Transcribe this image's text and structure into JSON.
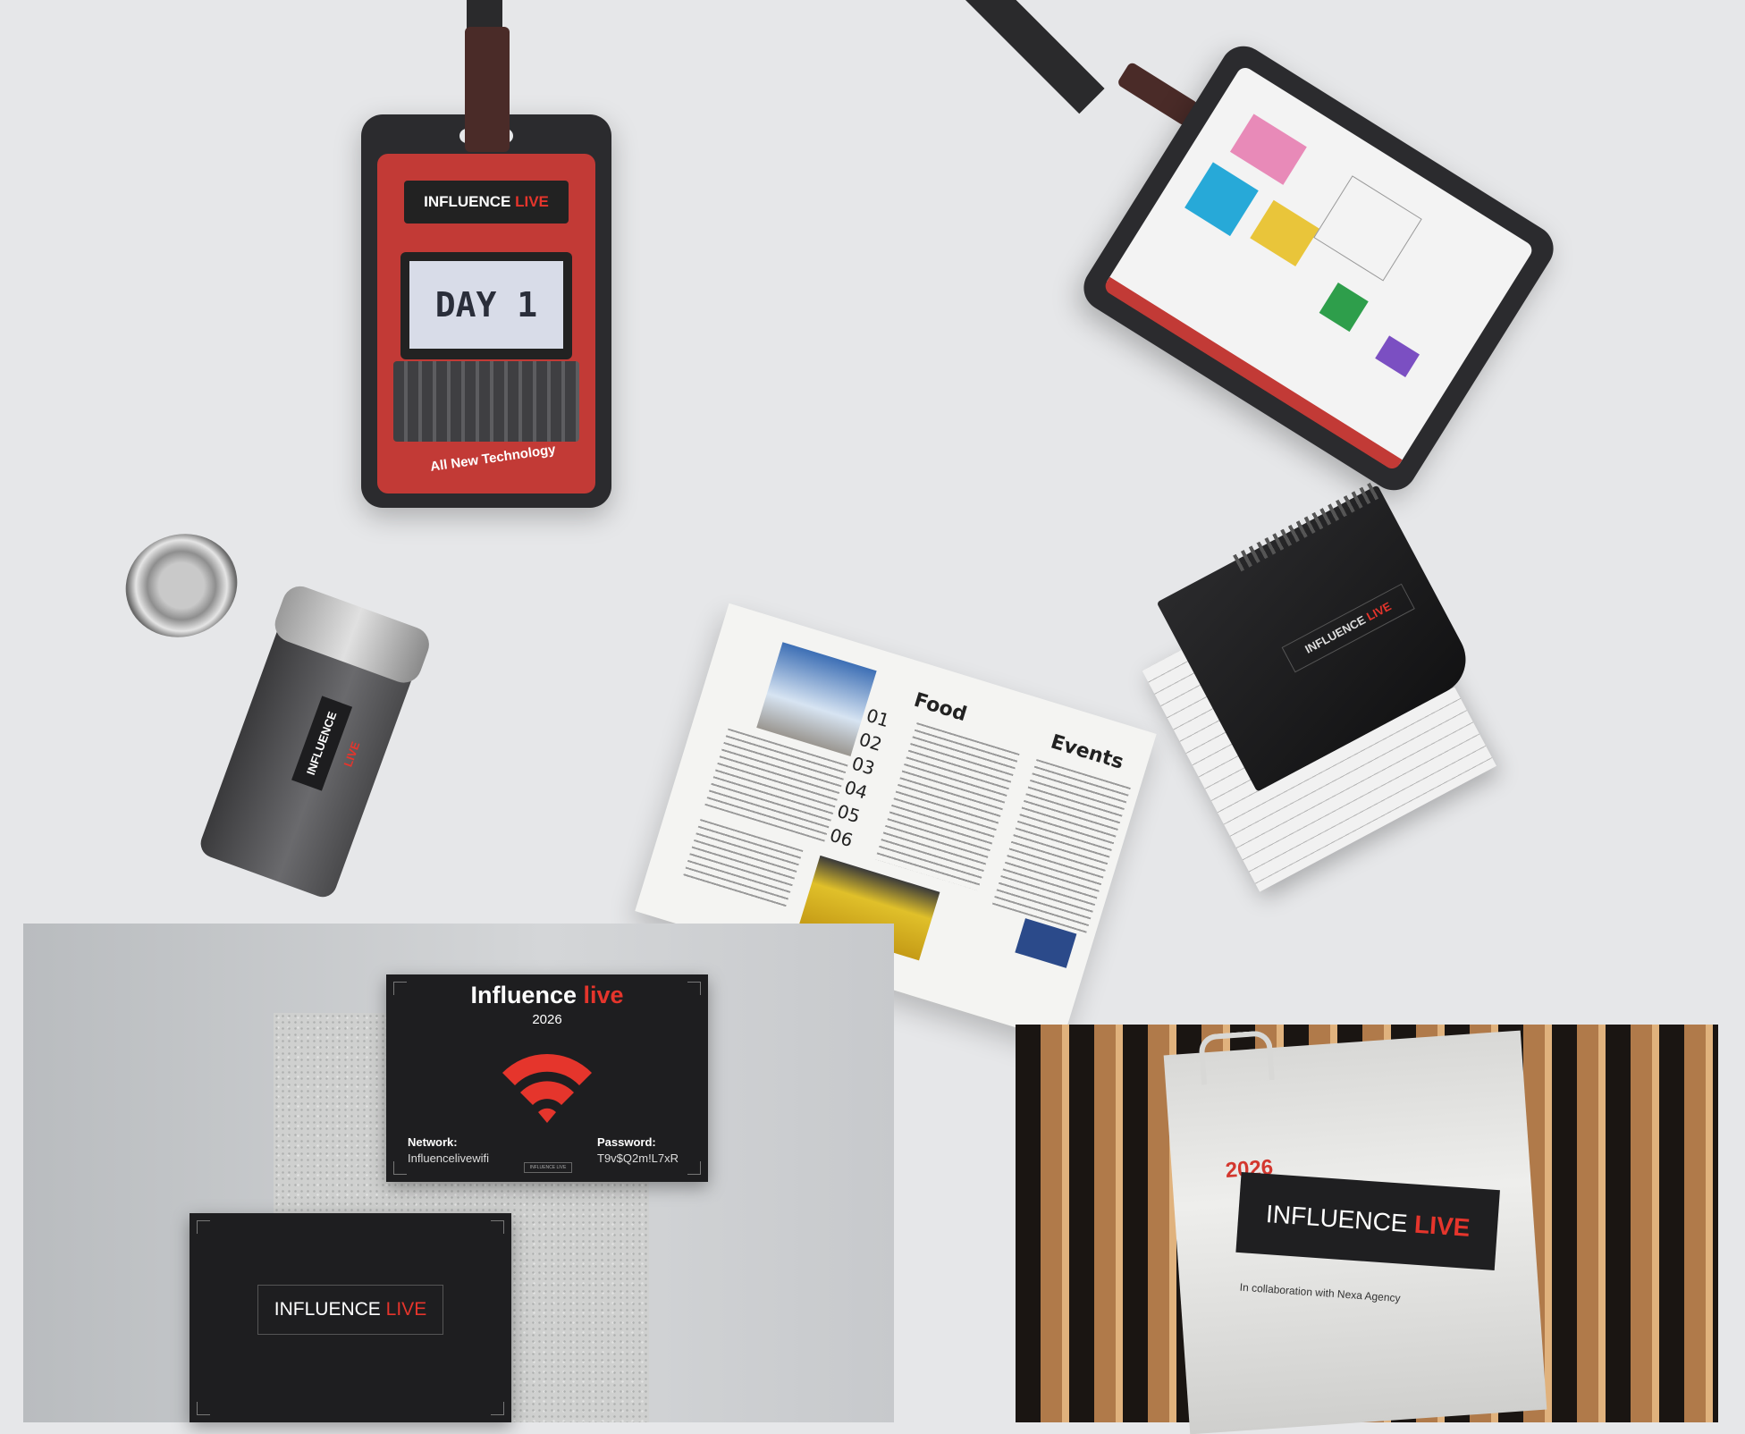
{
  "brand": {
    "name_white": "INFLUENCE",
    "name_red": "LIVE",
    "accent": "#e5352c",
    "badge_red": "#c23a36"
  },
  "badge_day": {
    "screen_text": "DAY 1",
    "tagline": "All New Technology"
  },
  "brochure": {
    "food_heading": "Food",
    "events_heading": "Events",
    "numbers": [
      "01",
      "02",
      "03",
      "04",
      "05",
      "06"
    ]
  },
  "wifi_card": {
    "title_white": "Influence",
    "title_red": "live",
    "year": "2026",
    "icon": "wifi-icon",
    "network_label": "Network:",
    "network_value": "Influencelivewifi",
    "password_label": "Password:",
    "password_value": "T9v$Q2m!L7xR"
  },
  "tote": {
    "year": "2026",
    "logo_white": "INFLUENCE",
    "logo_red": "LIVE",
    "collab": "In collaboration with Nexa Agency"
  }
}
